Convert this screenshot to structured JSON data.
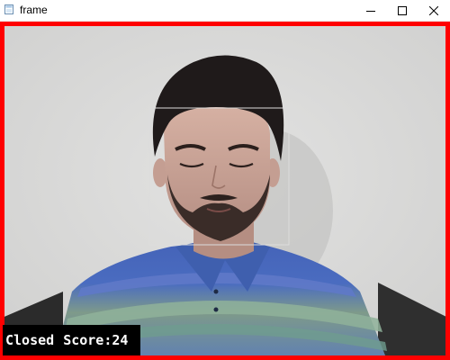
{
  "window": {
    "title": "frame",
    "icon": "app-window-icon",
    "controls": {
      "minimize_icon": "minimize-icon",
      "maximize_icon": "maximize-icon",
      "close_icon": "close-icon"
    }
  },
  "overlay": {
    "eye_state": "Closed",
    "score_text": "Score:24",
    "score_value": 24,
    "box_color": "#000000",
    "text_color": "#ffffff"
  },
  "colors": {
    "frame_border": "#ff0000",
    "face_box": "#dcdcdc",
    "background_wall": "#d8d8d7"
  }
}
